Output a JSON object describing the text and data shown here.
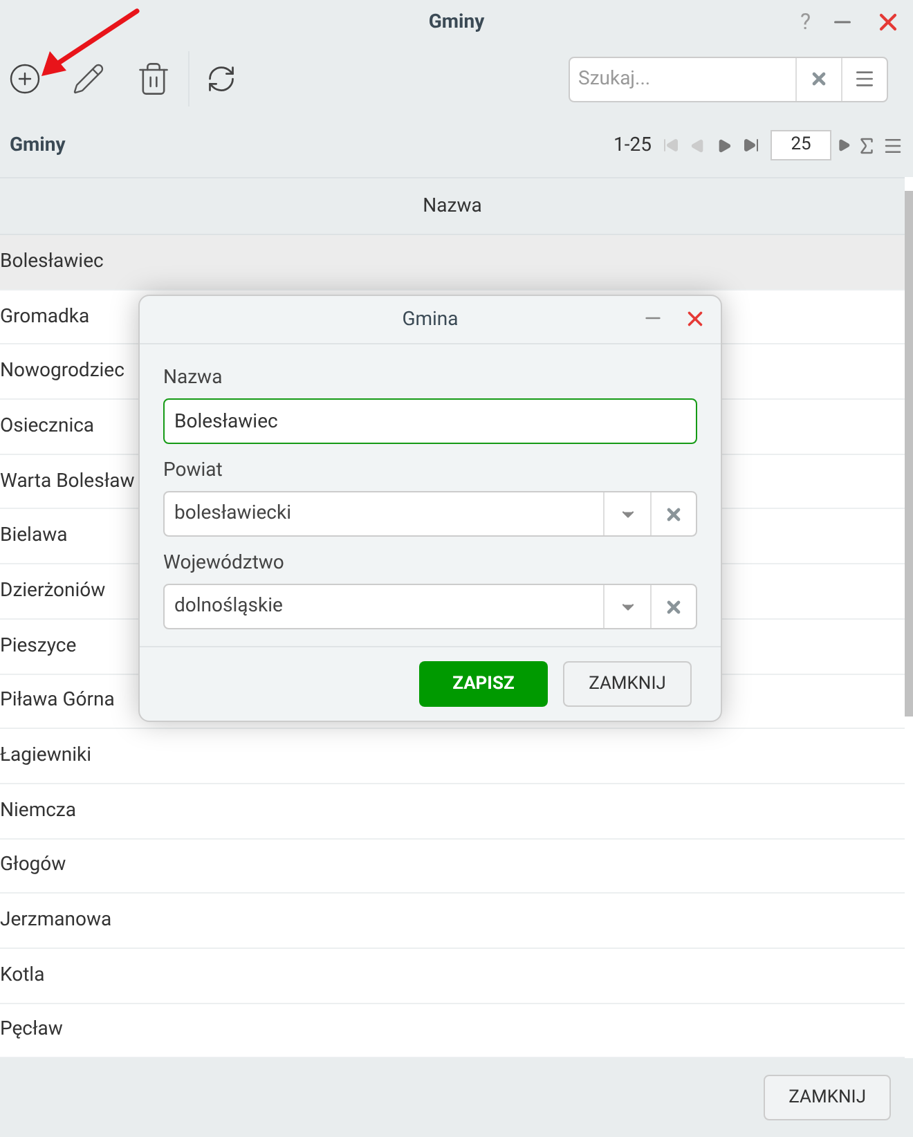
{
  "window": {
    "title": "Gminy",
    "help": "?"
  },
  "toolbar": {
    "search": {
      "placeholder": "Szukaj..."
    }
  },
  "grid": {
    "title": "Gminy",
    "range": "1-25",
    "page_size": "25",
    "columns": [
      "Nazwa"
    ],
    "rows": [
      {
        "name": "Bolesławiec",
        "selected": true
      },
      {
        "name": "Gromadka",
        "selected": false
      },
      {
        "name": "Nowogrodziec",
        "selected": false
      },
      {
        "name": "Osiecznica",
        "selected": false
      },
      {
        "name": "Warta Bolesław",
        "selected": false
      },
      {
        "name": "Bielawa",
        "selected": false
      },
      {
        "name": "Dzierżoniów",
        "selected": false
      },
      {
        "name": "Pieszyce",
        "selected": false
      },
      {
        "name": "Piława Górna",
        "selected": false
      },
      {
        "name": "Łagiewniki",
        "selected": false
      },
      {
        "name": "Niemcza",
        "selected": false
      },
      {
        "name": "Głogów",
        "selected": false
      },
      {
        "name": "Jerzmanowa",
        "selected": false
      },
      {
        "name": "Kotla",
        "selected": false
      },
      {
        "name": "Pęcław",
        "selected": false
      }
    ]
  },
  "dialog": {
    "title": "Gmina",
    "fields": [
      {
        "label": "Nazwa",
        "value": "Bolesławiec",
        "kind": "text"
      },
      {
        "label": "Powiat",
        "value": "bolesławiecki",
        "kind": "select"
      },
      {
        "label": "Województwo",
        "value": "dolnośląskie",
        "kind": "select"
      }
    ],
    "buttons": [
      {
        "label": "ZAPISZ",
        "kind": "primary"
      },
      {
        "label": "ZAMKNIJ",
        "kind": "secondary"
      }
    ]
  },
  "footer": {
    "buttons": [
      "ZAMKNIJ"
    ]
  }
}
